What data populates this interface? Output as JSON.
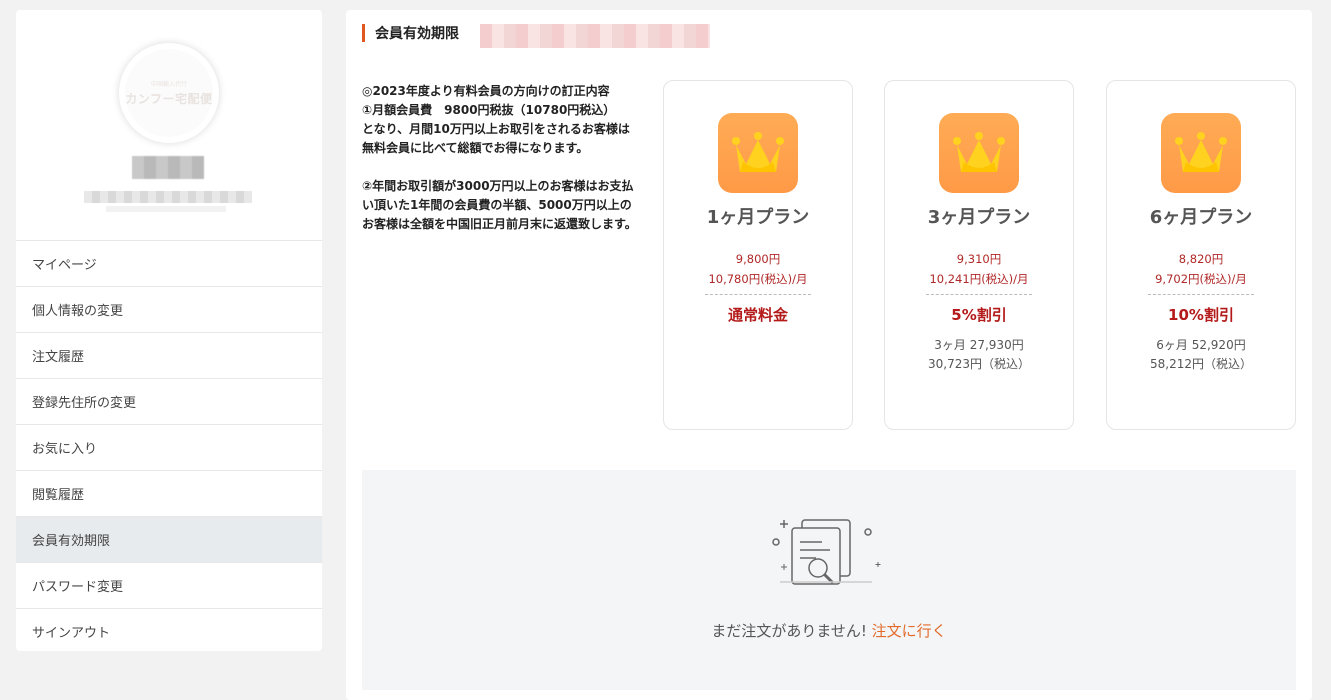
{
  "sidebar": {
    "logo_line1": "中国輸入代行",
    "logo_line2": "カンフー宅配便",
    "menu": [
      {
        "label": "マイページ"
      },
      {
        "label": "個人情報の変更"
      },
      {
        "label": "注文履歴"
      },
      {
        "label": "登録先住所の変更"
      },
      {
        "label": "お気に入り"
      },
      {
        "label": "閲覧履歴"
      },
      {
        "label": "会員有効期限",
        "active": true
      },
      {
        "label": "パスワード変更"
      },
      {
        "label": "サインアウト"
      }
    ]
  },
  "main": {
    "title": "会員有効期限",
    "notice": {
      "para1": "◎2023年度より有料会員の方向けの訂正内容\n①月額会員費　9800円税抜（10780円税込）\nとなり、月間10万円以上お取引をされるお客様は無料会員に比べて総額でお得になります。",
      "para2": "②年間お取引額が3000万円以上のお客様はお支払い頂いた1年間の会員費の半額、5000万円以上のお客様は全額を中国旧正月前月末に返還致します。"
    },
    "plans": [
      {
        "name": "1ヶ月プラン",
        "price": "9,800円",
        "price_tax": "10,780円(税込)/月",
        "discount": "通常料金",
        "total": "",
        "total_tax": ""
      },
      {
        "name": "3ヶ月プラン",
        "price": "9,310円",
        "price_tax": "10,241円(税込)/月",
        "discount": "5%割引",
        "total": "3ヶ月 27,930円",
        "total_tax": "30,723円（税込）"
      },
      {
        "name": "6ヶ月プラン",
        "price": "8,820円",
        "price_tax": "9,702円(税込)/月",
        "discount": "10%割引",
        "total": "6ヶ月 52,920円",
        "total_tax": "58,212円（税込）"
      }
    ],
    "empty": {
      "text": "まだ注文がありません! ",
      "link": "注文に行く"
    }
  },
  "colors": {
    "accent": "#e2571e",
    "crown_bg": "#ff9f4b",
    "price_red": "#b02828",
    "link": "#e26b2a"
  }
}
